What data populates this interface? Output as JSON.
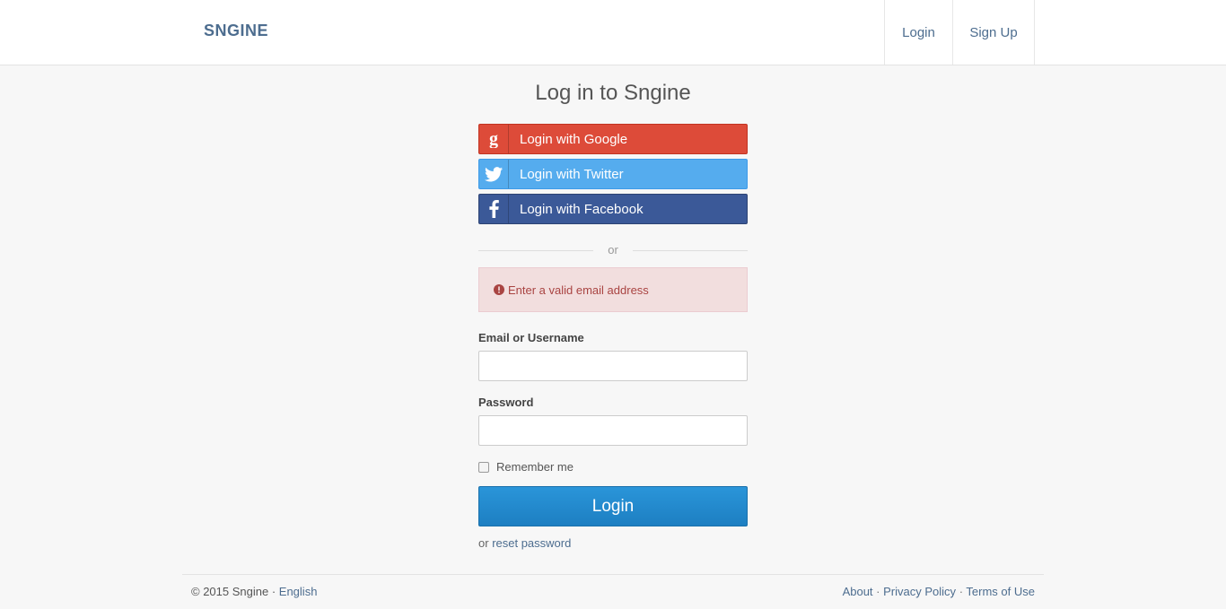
{
  "header": {
    "brand": "SNGINE",
    "nav": {
      "login": "Login",
      "signup": "Sign Up"
    }
  },
  "main": {
    "title": "Log in to Sngine",
    "social": {
      "google": "Login with Google",
      "twitter": "Login with Twitter",
      "facebook": "Login with Facebook"
    },
    "divider": "or",
    "alert": "Enter a valid email address",
    "email_label": "Email or Username",
    "email_value": "",
    "password_label": "Password",
    "password_value": "",
    "remember_label": "Remember me",
    "remember_checked": false,
    "login_button": "Login",
    "reset_prefix": "or",
    "reset_link": "reset password"
  },
  "footer": {
    "copyright": "© 2015 Sngine ·",
    "language": "English",
    "links": {
      "about": "About",
      "privacy": "Privacy Policy",
      "terms": "Terms of Use"
    },
    "separator": "·"
  },
  "colors": {
    "brand": "#4d6d8f",
    "google": "#dd4b39",
    "twitter": "#55acee",
    "facebook": "#3b5998",
    "primary": "#1d7fc2",
    "alert_bg": "#f2dede",
    "alert_text": "#a94442"
  },
  "icons": {
    "google": "google-icon",
    "twitter": "twitter-icon",
    "facebook": "facebook-icon",
    "alert": "exclamation-circle-icon"
  }
}
